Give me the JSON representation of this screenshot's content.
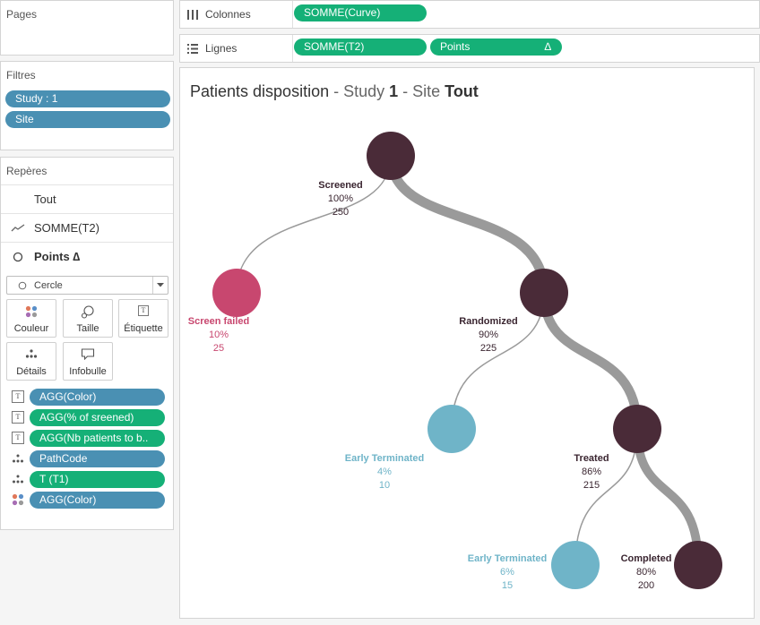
{
  "pages": {
    "title": "Pages"
  },
  "filters": {
    "title": "Filtres",
    "items": [
      {
        "label": "Study : 1"
      },
      {
        "label": "Site"
      }
    ]
  },
  "marks": {
    "title": "Repères",
    "rows": [
      {
        "label": "Tout"
      },
      {
        "label": "SOMME(T2)"
      },
      {
        "label": "Points ∆"
      }
    ],
    "mark_type": "Cercle",
    "buttons": [
      {
        "label": "Couleur",
        "icon": "color-dots-icon"
      },
      {
        "label": "Taille",
        "icon": "size-icon"
      },
      {
        "label": "Étiquette",
        "icon": "label-icon"
      },
      {
        "label": "Détails",
        "icon": "details-icon"
      },
      {
        "label": "Infobulle",
        "icon": "tooltip-icon"
      }
    ],
    "fields": [
      {
        "label": "AGG(Color)",
        "color": "blue",
        "icon": "label-icon"
      },
      {
        "label": "AGG(% of sreened)",
        "color": "green",
        "icon": "label-icon"
      },
      {
        "label": "AGG(Nb patients to b..",
        "color": "green",
        "icon": "label-icon"
      },
      {
        "label": "PathCode",
        "color": "blue",
        "icon": "details-icon"
      },
      {
        "label": "T (T1)",
        "color": "green",
        "icon": "details-icon"
      },
      {
        "label": "AGG(Color)",
        "color": "blue",
        "icon": "color-dots-icon"
      }
    ]
  },
  "shelves": {
    "columns": {
      "label": "Colonnes",
      "pills": [
        "SOMME(Curve)"
      ]
    },
    "rows": {
      "label": "Lignes",
      "pills": [
        "SOMME(T2)",
        "Points"
      ],
      "delta": "∆"
    }
  },
  "viz": {
    "title_main": "Patients disposition",
    "title_sep1": " - Study ",
    "title_study": "1",
    "title_sep2": " - Site ",
    "title_site": "Tout",
    "colors": {
      "dark": "#4a2b38",
      "pink": "#c8476f",
      "light_blue": "#6fb4c8",
      "link": "#9a9a9a"
    },
    "nodes": [
      {
        "id": "root",
        "color": "dark",
        "label": "Screened",
        "pct": "100%",
        "count": "250"
      },
      {
        "id": "screen-failed",
        "color": "pink",
        "label": "Screen failed",
        "pct": "10%",
        "count": "25"
      },
      {
        "id": "randomized",
        "color": "dark",
        "label": "Randomized",
        "pct": "90%",
        "count": "225"
      },
      {
        "id": "early-terminated-1",
        "color": "light_blue",
        "label": "Early Terminated",
        "pct": "4%",
        "count": "10"
      },
      {
        "id": "treated",
        "color": "dark",
        "label": "Treated",
        "pct": "86%",
        "count": "215"
      },
      {
        "id": "early-terminated-2",
        "color": "light_blue",
        "label": "Early Terminated",
        "pct": "6%",
        "count": "15"
      },
      {
        "id": "completed",
        "color": "dark",
        "label": "Completed",
        "pct": "80%",
        "count": "200"
      }
    ],
    "links": [
      {
        "from": "root",
        "to": "screen-failed",
        "count": 25
      },
      {
        "from": "root",
        "to": "randomized",
        "count": 225
      },
      {
        "from": "randomized",
        "to": "early-terminated-1",
        "count": 10
      },
      {
        "from": "randomized",
        "to": "treated",
        "count": 215
      },
      {
        "from": "treated",
        "to": "early-terminated-2",
        "count": 15
      },
      {
        "from": "treated",
        "to": "completed",
        "count": 200
      }
    ]
  }
}
